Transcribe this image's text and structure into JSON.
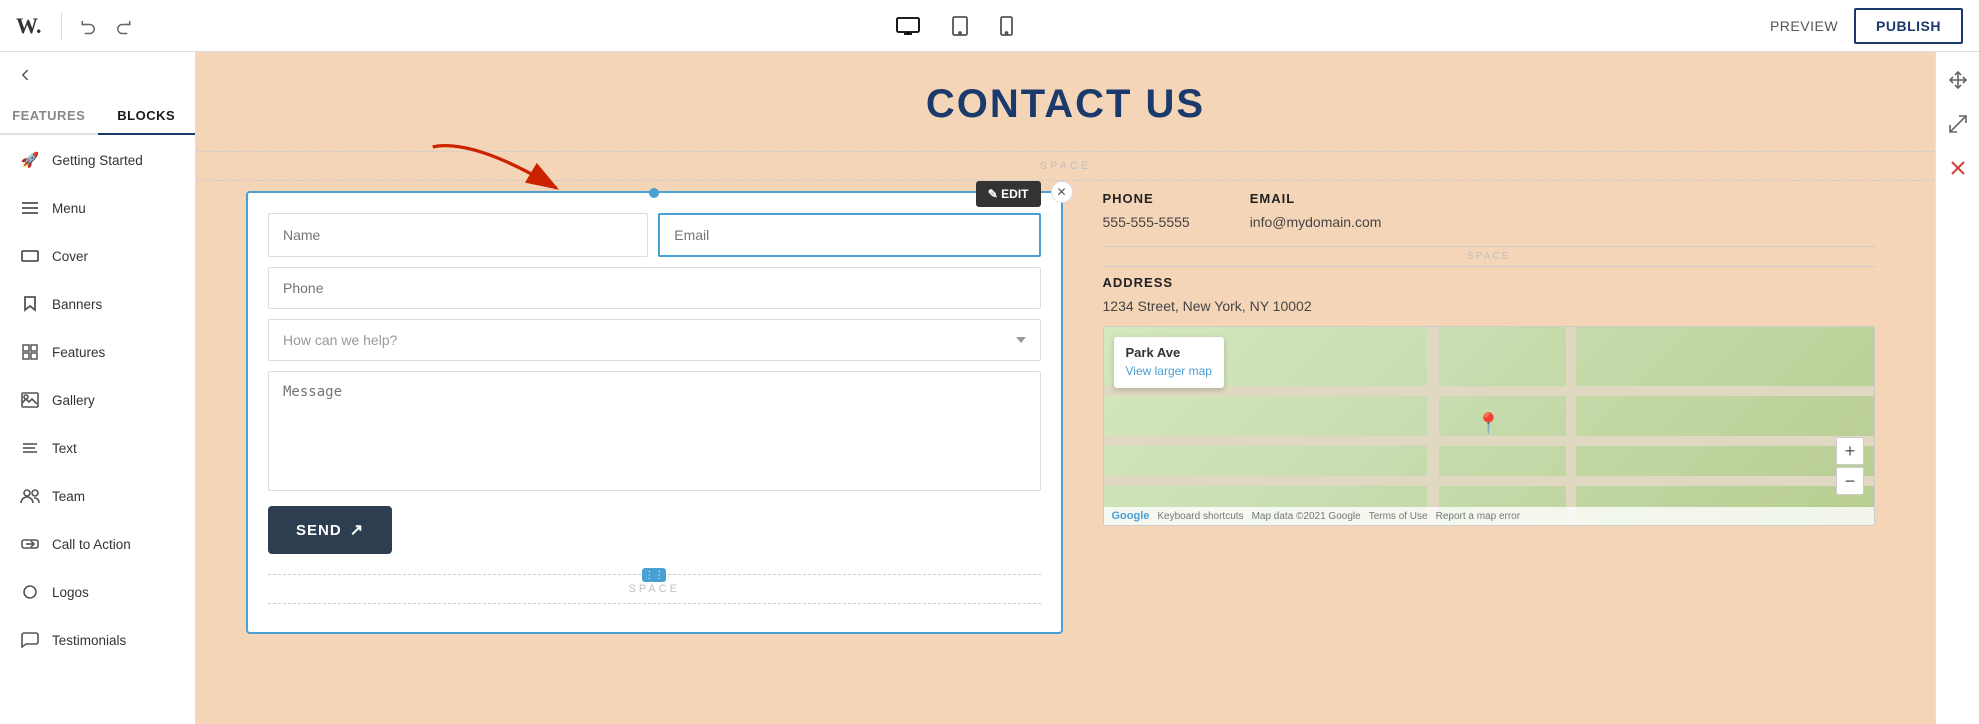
{
  "topbar": {
    "logo": "W.",
    "preview_label": "PREVIEW",
    "publish_label": "PUBLISH",
    "undo_icon": "↩",
    "redo_icon": "↪"
  },
  "devices": [
    {
      "label": "Desktop",
      "icon": "desktop"
    },
    {
      "label": "Tablet",
      "icon": "tablet"
    },
    {
      "label": "Mobile",
      "icon": "mobile"
    }
  ],
  "sidebar": {
    "features_tab": "FEATURES",
    "blocks_tab": "BLOCKS",
    "items": [
      {
        "label": "Getting Started",
        "icon": "🚀"
      },
      {
        "label": "Menu",
        "icon": "☰"
      },
      {
        "label": "Cover",
        "icon": "▭"
      },
      {
        "label": "Banners",
        "icon": "⚑"
      },
      {
        "label": "Features",
        "icon": "⊞"
      },
      {
        "label": "Gallery",
        "icon": "📷"
      },
      {
        "label": "Text",
        "icon": "𝔸≡"
      },
      {
        "label": "Team",
        "icon": "👥"
      },
      {
        "label": "Call to Action",
        "icon": "↗"
      },
      {
        "label": "Logos",
        "icon": "◯"
      },
      {
        "label": "Testimonials",
        "icon": "❝❝"
      }
    ]
  },
  "canvas": {
    "heading": "CONTACT US",
    "space_label": "SPACE",
    "form": {
      "name_placeholder": "Name",
      "email_placeholder": "Email",
      "phone_placeholder": "Phone",
      "help_placeholder": "How can we help?",
      "message_placeholder": "Message",
      "send_label": "SEND",
      "edit_label": "✎ EDIT"
    },
    "contact_info": {
      "phone_heading": "PHONE",
      "phone_value": "555-555-5555",
      "email_heading": "EMAIL",
      "email_value": "info@mydomain.com",
      "address_heading": "ADDRESS",
      "address_value": "1234 Street, New York, NY 10002"
    },
    "map": {
      "popup_title": "Park Ave",
      "popup_link": "View larger map",
      "keyboard_shortcuts": "Keyboard shortcuts",
      "map_data": "Map data ©2021 Google",
      "terms": "Terms of Use",
      "report": "Report a map error"
    }
  },
  "right_panel": {
    "move_icon": "✛",
    "resize_icon": "⤢",
    "close_icon": "✕"
  }
}
